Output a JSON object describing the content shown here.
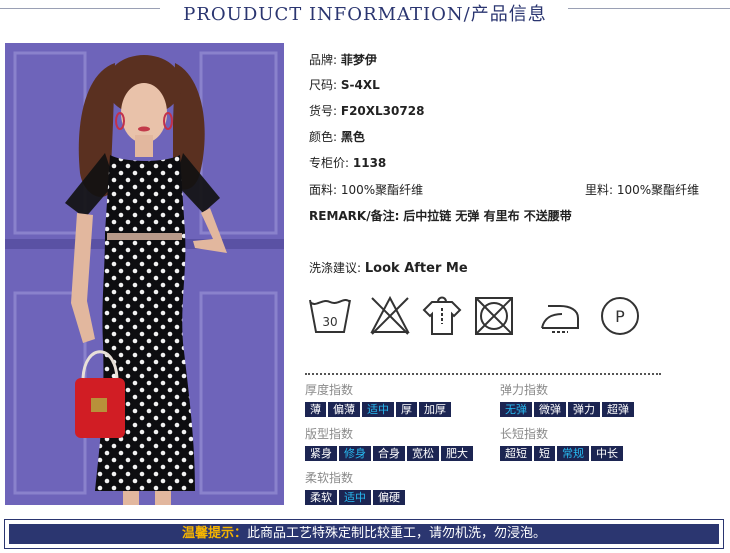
{
  "header": {
    "title": "PROUDUCT INFORMATION/产品信息"
  },
  "info": {
    "brand": {
      "label": "品牌:",
      "value": "菲梦伊"
    },
    "size": {
      "label": "尺码:",
      "value": "S-4XL"
    },
    "sku": {
      "label": "货号:",
      "value": "F20XL30728"
    },
    "color": {
      "label": "颜色:",
      "value": "黑色"
    },
    "price": {
      "label": "专柜价:",
      "value": "1138"
    },
    "fabric": {
      "label": "面料:",
      "value": "100%聚酯纤维"
    },
    "lining": {
      "label": "里料:",
      "value": "100%聚酯纤维"
    },
    "remark": {
      "label": "REMARK/备注:",
      "value": "后中拉链 无弹 有里布 不送腰带"
    },
    "wash": {
      "label": "洗涤建议:",
      "value": "Look After Me"
    }
  },
  "care_icons": {
    "wash_temp": "30",
    "iron_text": "P",
    "names": [
      "wash-30-icon",
      "no-bleach-icon",
      "hang-dry-icon",
      "no-tumble-dry-icon",
      "iron-low-icon",
      "dry-clean-p-icon"
    ]
  },
  "indices": {
    "thickness": {
      "title": "厚度指数",
      "options": [
        "薄",
        "偏薄",
        "适中",
        "厚",
        "加厚"
      ],
      "selected": "适中"
    },
    "elasticity": {
      "title": "弹力指数",
      "options": [
        "无弹",
        "微弹",
        "弹力",
        "超弹"
      ],
      "selected": "无弹"
    },
    "fit": {
      "title": "版型指数",
      "options": [
        "紧身",
        "修身",
        "合身",
        "宽松",
        "肥大"
      ],
      "selected": "修身"
    },
    "length": {
      "title": "长短指数",
      "options": [
        "超短",
        "短",
        "常规",
        "中长"
      ],
      "selected": "常规"
    },
    "softness": {
      "title": "柔软指数",
      "options": [
        "柔软",
        "适中",
        "偏硬"
      ],
      "selected": "适中"
    }
  },
  "notice": {
    "label": "温馨提示：",
    "text": "此商品工艺特殊定制比较重工，请勿机洗，勿浸泡。"
  },
  "colors": {
    "navy": "#1c2552",
    "selected": "#27b9f0",
    "notice_label": "#f6b400",
    "backdrop": "#6d63b8"
  }
}
